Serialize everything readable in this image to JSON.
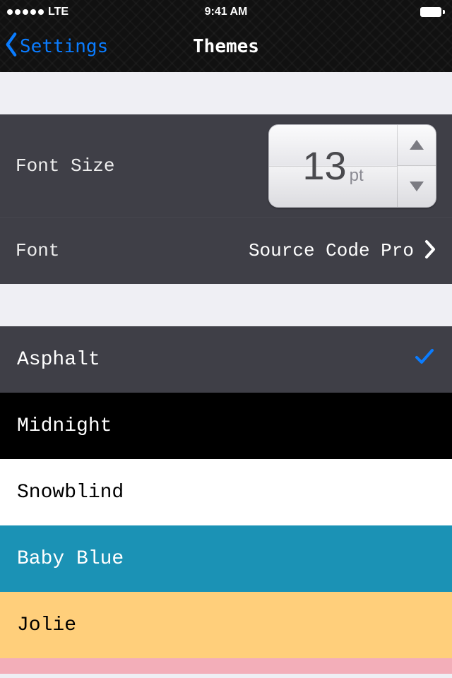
{
  "status": {
    "carrier": "LTE",
    "time": "9:41 AM"
  },
  "nav": {
    "back_label": "Settings",
    "title": "Themes"
  },
  "settings": {
    "font_size_label": "Font Size",
    "font_size_value": "13",
    "font_size_unit": "pt",
    "font_label": "Font",
    "font_value": "Source Code Pro"
  },
  "themes": [
    {
      "name": "Asphalt",
      "selected": true
    },
    {
      "name": "Midnight",
      "selected": false
    },
    {
      "name": "Snowblind",
      "selected": false
    },
    {
      "name": "Baby Blue",
      "selected": false
    },
    {
      "name": "Jolie",
      "selected": false
    }
  ],
  "colors": {
    "accent": "#0a7cff"
  }
}
